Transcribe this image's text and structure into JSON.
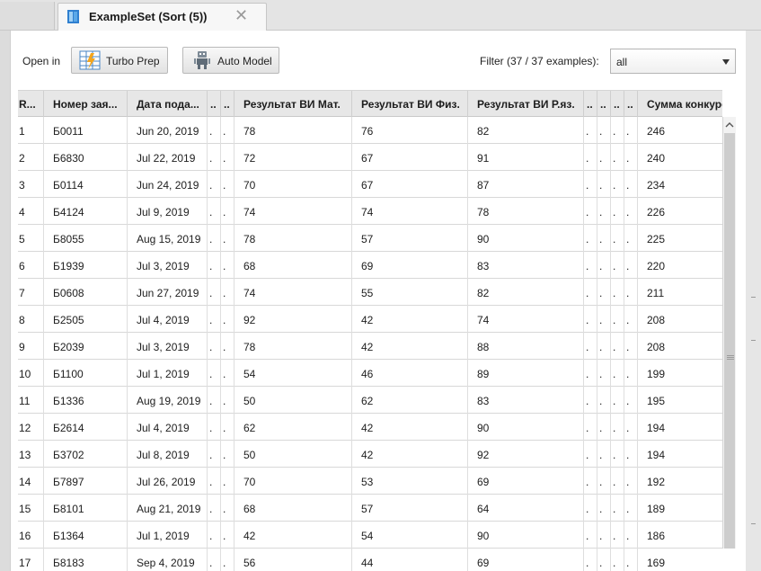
{
  "tab": {
    "title": "ExampleSet (Sort (5))",
    "icon": "example-set-icon",
    "close_glyph": "✕"
  },
  "toolbar": {
    "open_in_label": "Open in",
    "turbo_prep_label": "Turbo Prep",
    "auto_model_label": "Auto Model",
    "filter_label": "Filter (37 / 37 examples):",
    "filter_value": "all"
  },
  "table": {
    "headers": [
      "R...",
      "Номер зая...",
      "Дата пода...",
      "..",
      "..",
      "Результат ВИ Мат.",
      "Результат ВИ Физ.",
      "Результат ВИ Р.яз.",
      "..",
      "..",
      "..",
      "..",
      "Сумма конкурс"
    ],
    "rows": [
      [
        "1",
        "Б0011",
        "Jun 20, 2019",
        ".",
        ".",
        "78",
        "76",
        "82",
        ".",
        ".",
        ".",
        ".",
        "246"
      ],
      [
        "2",
        "Б6830",
        "Jul 22, 2019",
        ".",
        ".",
        "72",
        "67",
        "91",
        ".",
        ".",
        ".",
        ".",
        "240"
      ],
      [
        "3",
        "Б0114",
        "Jun 24, 2019",
        ".",
        ".",
        "70",
        "67",
        "87",
        ".",
        ".",
        ".",
        ".",
        "234"
      ],
      [
        "4",
        "Б4124",
        "Jul 9, 2019",
        ".",
        ".",
        "74",
        "74",
        "78",
        ".",
        ".",
        ".",
        ".",
        "226"
      ],
      [
        "5",
        "Б8055",
        "Aug 15, 2019",
        ".",
        ".",
        "78",
        "57",
        "90",
        ".",
        ".",
        ".",
        ".",
        "225"
      ],
      [
        "6",
        "Б1939",
        "Jul 3, 2019",
        ".",
        ".",
        "68",
        "69",
        "83",
        ".",
        ".",
        ".",
        ".",
        "220"
      ],
      [
        "7",
        "Б0608",
        "Jun 27, 2019",
        ".",
        ".",
        "74",
        "55",
        "82",
        ".",
        ".",
        ".",
        ".",
        "211"
      ],
      [
        "8",
        "Б2505",
        "Jul 4, 2019",
        ".",
        ".",
        "92",
        "42",
        "74",
        ".",
        ".",
        ".",
        ".",
        "208"
      ],
      [
        "9",
        "Б2039",
        "Jul 3, 2019",
        ".",
        ".",
        "78",
        "42",
        "88",
        ".",
        ".",
        ".",
        ".",
        "208"
      ],
      [
        "10",
        "Б1100",
        "Jul 1, 2019",
        ".",
        ".",
        "54",
        "46",
        "89",
        ".",
        ".",
        ".",
        ".",
        "199"
      ],
      [
        "11",
        "Б1336",
        "Aug 19, 2019",
        ".",
        ".",
        "50",
        "62",
        "83",
        ".",
        ".",
        ".",
        ".",
        "195"
      ],
      [
        "12",
        "Б2614",
        "Jul 4, 2019",
        ".",
        ".",
        "62",
        "42",
        "90",
        ".",
        ".",
        ".",
        ".",
        "194"
      ],
      [
        "13",
        "Б3702",
        "Jul 8, 2019",
        ".",
        ".",
        "50",
        "42",
        "92",
        ".",
        ".",
        ".",
        ".",
        "194"
      ],
      [
        "14",
        "Б7897",
        "Jul 26, 2019",
        ".",
        ".",
        "70",
        "53",
        "69",
        ".",
        ".",
        ".",
        ".",
        "192"
      ],
      [
        "15",
        "Б8101",
        "Aug 21, 2019",
        ".",
        ".",
        "68",
        "57",
        "64",
        ".",
        ".",
        ".",
        ".",
        "189"
      ],
      [
        "16",
        "Б1364",
        "Jul 1, 2019",
        ".",
        ".",
        "42",
        "54",
        "90",
        ".",
        ".",
        ".",
        ".",
        "186"
      ],
      [
        "17",
        "Б8183",
        "Sep 4, 2019",
        ".",
        ".",
        "56",
        "44",
        "69",
        ".",
        ".",
        ".",
        ".",
        "169"
      ]
    ]
  }
}
